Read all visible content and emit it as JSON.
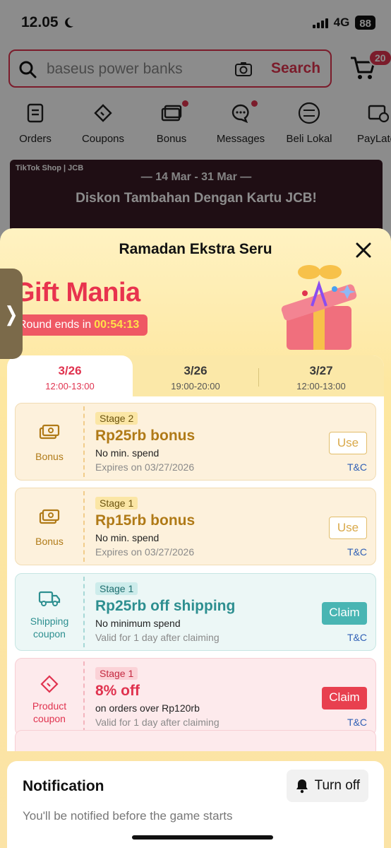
{
  "status": {
    "time": "12.05",
    "network": "4G",
    "battery": "88"
  },
  "search": {
    "query": "baseus power banks",
    "button": "Search",
    "cart_count": "20"
  },
  "quick_nav": [
    {
      "label": "Orders"
    },
    {
      "label": "Coupons"
    },
    {
      "label": "Bonus"
    },
    {
      "label": "Messages"
    },
    {
      "label": "Beli Lokal"
    },
    {
      "label": "PayLater"
    }
  ],
  "banner": {
    "brand": "TikTok Shop | JCB",
    "date": "— 14 Mar - 31 Mar —",
    "headline": "Diskon Tambahan Dengan Kartu JCB!"
  },
  "sheet": {
    "title": "Ramadan Ekstra Seru",
    "game_title": "Gift Mania",
    "round_label": "Round ends in",
    "countdown": "00:54:13",
    "side_arrow": "❭"
  },
  "tabs": [
    {
      "date": "3/26",
      "time": "12:00-13:00",
      "active": true
    },
    {
      "date": "3/26",
      "time": "19:00-20:00",
      "active": false
    },
    {
      "date": "3/27",
      "time": "12:00-13:00",
      "active": false
    }
  ],
  "rewards": [
    {
      "type_label": "Bonus",
      "stage": "Stage 2",
      "name": "Rp25rb bonus",
      "condition": "No min. spend",
      "expiry": "Expires on 03/27/2026",
      "action": "Use",
      "tc": "T&C"
    },
    {
      "type_label": "Bonus",
      "stage": "Stage 1",
      "name": "Rp15rb bonus",
      "condition": "No min. spend",
      "expiry": "Expires on 03/27/2026",
      "action": "Use",
      "tc": "T&C"
    },
    {
      "type_label_1": "Shipping",
      "type_label_2": "coupon",
      "stage": "Stage 1",
      "name": "Rp25rb off shipping",
      "condition": "No minimum spend",
      "expiry": "Valid for 1 day after claiming",
      "action": "Claim",
      "tc": "T&C"
    },
    {
      "type_label_1": "Product",
      "type_label_2": "coupon",
      "stage": "Stage 1",
      "name": "8% off",
      "condition": "on orders over Rp120rb",
      "expiry": "Valid for 1 day after claiming",
      "action": "Claim",
      "tc": "T&C"
    }
  ],
  "notification": {
    "title": "Notification",
    "subtitle": "You'll be notified before the game starts",
    "button": "Turn off"
  },
  "colors": {
    "accent": "#e0334f",
    "bonus": "#b07a17",
    "shipping": "#2d8f90"
  }
}
